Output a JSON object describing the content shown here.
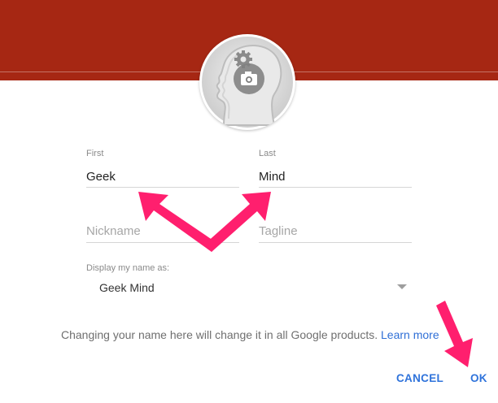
{
  "colors": {
    "header": "#a62713",
    "accent": "#2f73db",
    "annotation_arrow": "#ff1f6e"
  },
  "profile_photo": {
    "icon": "head-profile-with-camera-icon"
  },
  "form": {
    "first": {
      "label": "First",
      "value": "Geek"
    },
    "last": {
      "label": "Last",
      "value": "Mind"
    },
    "nickname": {
      "placeholder": "Nickname"
    },
    "tagline": {
      "placeholder": "Tagline"
    },
    "display_name": {
      "label": "Display my name as:",
      "value": "Geek Mind"
    }
  },
  "info": {
    "text": "Changing your name here will change it in all Google products.",
    "link": "Learn more"
  },
  "buttons": {
    "cancel": "CANCEL",
    "ok": "OK"
  }
}
